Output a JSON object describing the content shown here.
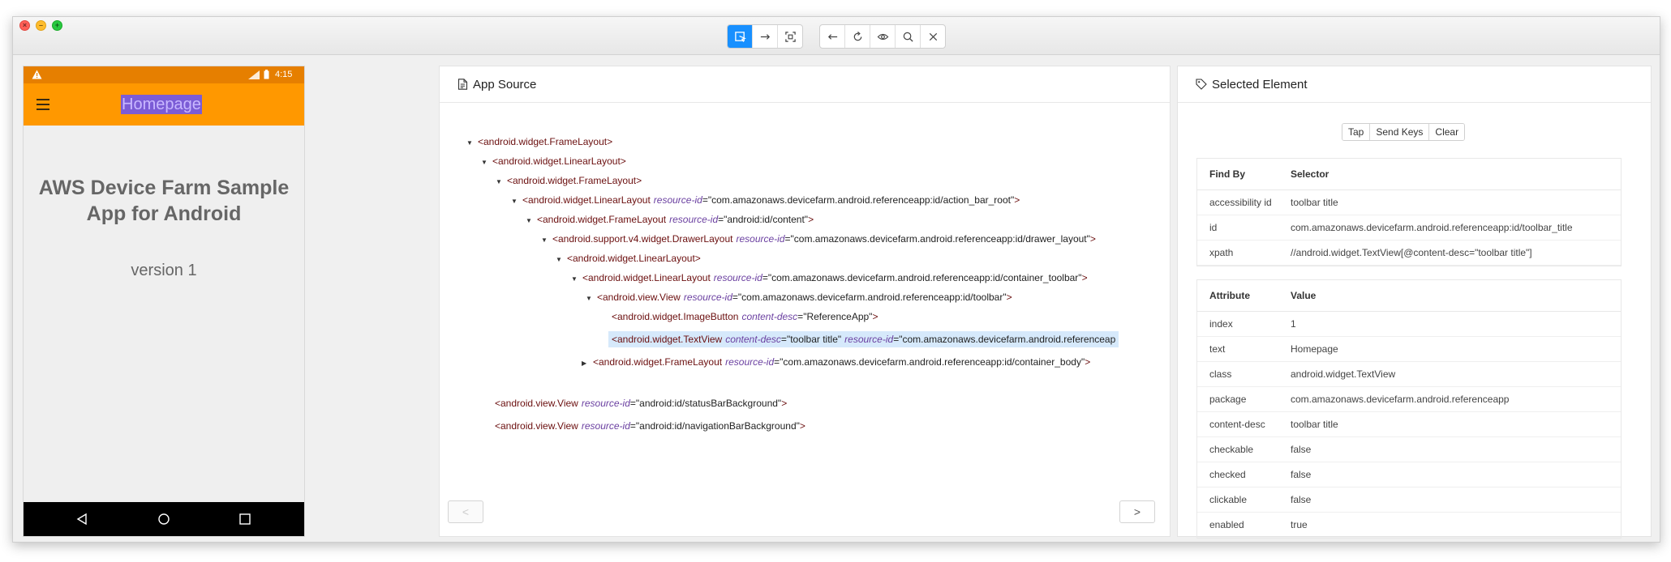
{
  "window": {
    "toolbar_left": [
      "select-elements-icon",
      "swipe-arrow-icon",
      "screenshot-icon"
    ],
    "toolbar_right": [
      "back-icon",
      "refresh-icon",
      "eye-icon",
      "search-icon",
      "close-icon"
    ],
    "accent": "#1890ff"
  },
  "device": {
    "status_time": "4:15",
    "toolbar_title": "Homepage",
    "heading_line1": "AWS Device Farm Sample",
    "heading_line2": "App for Android",
    "version": "version 1",
    "colors": {
      "statusbar": "#e67f00",
      "toolbar": "#ff9800",
      "highlight": "#7b5cd6"
    }
  },
  "source": {
    "title": "App Source",
    "nodes": [
      {
        "caret": "▼",
        "tag": "<android.widget.FrameLayout>",
        "attrs": []
      },
      {
        "caret": "▼",
        "tag": "<android.widget.LinearLayout>",
        "attrs": []
      },
      {
        "caret": "▼",
        "tag": "<android.widget.FrameLayout>",
        "attrs": []
      },
      {
        "caret": "▼",
        "tag": "<android.widget.LinearLayout",
        "attrs": [
          {
            "name": "resource-id",
            "value": "\"com.amazonaws.devicefarm.android.referenceapp:id/action_bar_root\""
          }
        ],
        "close": ">"
      },
      {
        "caret": "▼",
        "tag": "<android.widget.FrameLayout",
        "attrs": [
          {
            "name": "resource-id",
            "value": "\"android:id/content\""
          }
        ],
        "close": ">"
      },
      {
        "caret": "▼",
        "tag": "<android.support.v4.widget.DrawerLayout",
        "attrs": [
          {
            "name": "resource-id",
            "value": "\"com.amazonaws.devicefarm.android.referenceapp:id/drawer_layout\""
          }
        ],
        "close": ">"
      },
      {
        "caret": "▼",
        "tag": "<android.widget.LinearLayout>",
        "attrs": []
      },
      {
        "caret": "▼",
        "tag": "<android.widget.LinearLayout",
        "attrs": [
          {
            "name": "resource-id",
            "value": "\"com.amazonaws.devicefarm.android.referenceapp:id/container_toolbar\""
          }
        ],
        "close": ">"
      },
      {
        "caret": "▼",
        "tag": "<android.view.View",
        "attrs": [
          {
            "name": "resource-id",
            "value": "\"com.amazonaws.devicefarm.android.referenceapp:id/toolbar\""
          }
        ],
        "close": ">"
      },
      {
        "caret": "",
        "tag": "<android.widget.ImageButton",
        "attrs": [
          {
            "name": "content-desc",
            "value": "\"ReferenceApp\""
          }
        ],
        "close": ">"
      },
      {
        "caret": "",
        "tag": "<android.widget.TextView",
        "attrs": [
          {
            "name": "content-desc",
            "value": "\"toolbar title\""
          },
          {
            "name": "resource-id",
            "value": "\"com.amazonaws.devicefarm.android.referenceap"
          }
        ],
        "close": "",
        "selected": true
      },
      {
        "caret": "▶",
        "tag": "<android.widget.FrameLayout",
        "attrs": [
          {
            "name": "resource-id",
            "value": "\"com.amazonaws.devicefarm.android.referenceapp:id/container_body\""
          }
        ],
        "close": ">"
      },
      {
        "caret": "",
        "tag": "<android.view.View",
        "attrs": [
          {
            "name": "resource-id",
            "value": "\"android:id/statusBarBackground\""
          }
        ],
        "close": ">"
      },
      {
        "caret": "",
        "tag": "<android.view.View",
        "attrs": [
          {
            "name": "resource-id",
            "value": "\"android:id/navigationBarBackground\""
          }
        ],
        "close": ">"
      }
    ],
    "prev_label": "<",
    "next_label": ">"
  },
  "selected": {
    "title": "Selected Element",
    "actions": [
      "Tap",
      "Send Keys",
      "Clear"
    ],
    "selectors": {
      "headers": [
        "Find By",
        "Selector"
      ],
      "rows": [
        [
          "accessibility id",
          "toolbar title"
        ],
        [
          "id",
          "com.amazonaws.devicefarm.android.referenceapp:id/toolbar_title"
        ],
        [
          "xpath",
          "//android.widget.TextView[@content-desc=\"toolbar title\"]"
        ]
      ]
    },
    "attributes": {
      "headers": [
        "Attribute",
        "Value"
      ],
      "rows": [
        [
          "index",
          "1"
        ],
        [
          "text",
          "Homepage"
        ],
        [
          "class",
          "android.widget.TextView"
        ],
        [
          "package",
          "com.amazonaws.devicefarm.android.referenceapp"
        ],
        [
          "content-desc",
          "toolbar title"
        ],
        [
          "checkable",
          "false"
        ],
        [
          "checked",
          "false"
        ],
        [
          "clickable",
          "false"
        ],
        [
          "enabled",
          "true"
        ]
      ]
    }
  }
}
